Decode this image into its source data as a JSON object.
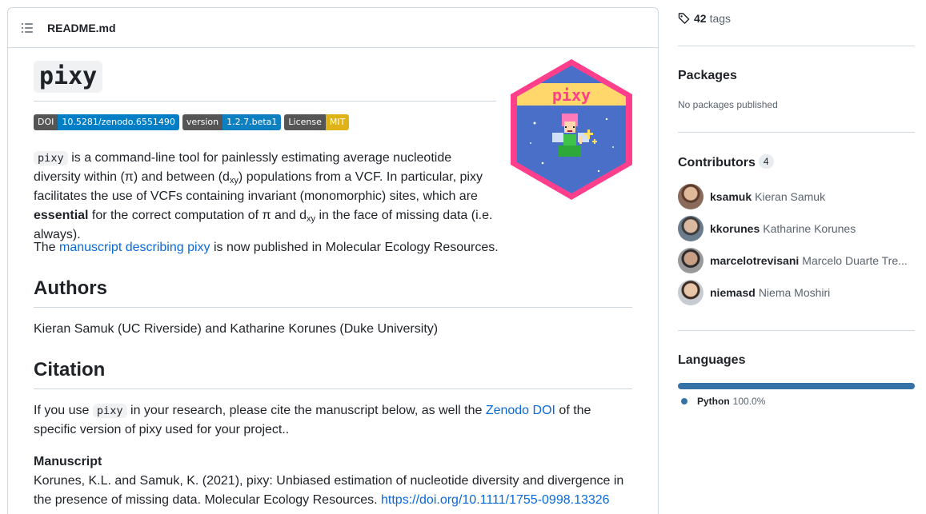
{
  "readme": {
    "filename": "README.md",
    "title": "pixy",
    "badges": [
      {
        "left": "DOI",
        "right": "10.5281/zenodo.6551490",
        "color": "#007ec6"
      },
      {
        "left": "version",
        "right": "1.2.7.beta1",
        "color": "#007ec6"
      },
      {
        "left": "License",
        "right": "MIT",
        "color": "#dfb317"
      }
    ],
    "logo_text": "pixy",
    "intro": {
      "code": "pixy",
      "t1": " is a command-line tool for painlessly estimating average nucleotide",
      "t2a": "diversity within (π) and between (d",
      "sub1": "xy",
      "t2b": ") populations from a VCF. In particular, pixy",
      "t3": "facilitates the use of VCFs containing invariant (monomorphic) sites, which are",
      "bold": "essential",
      "t4a": " for the correct computation of π and d",
      "sub2": "xy",
      "t4b": " in the face of missing data (i.e. always)."
    },
    "manuscript_line": {
      "pre": "The ",
      "link": "manuscript describing pixy",
      "post": " is now published in Molecular Ecology Resources."
    },
    "authors_heading": "Authors",
    "authors_text": "Kieran Samuk (UC Riverside) and Katharine Korunes (Duke University)",
    "citation_heading": "Citation",
    "citation": {
      "pre": "If you use ",
      "code": "pixy",
      "mid": " in your research, please cite the manuscript below, as well the ",
      "link": "Zenodo DOI",
      "post": " of the",
      "line2": "specific version of pixy used for your project.."
    },
    "manuscript_heading": "Manuscript",
    "manuscript_ref": {
      "line1": "Korunes, K.L. and Samuk, K. (2021), pixy: Unbiased estimation of nucleotide diversity and divergence in",
      "line2": "the presence of missing data. Molecular Ecology Resources. ",
      "doi": "https://doi.org/10.1111/1755-0998.13326"
    }
  },
  "sidebar": {
    "tags_count": "42",
    "tags_label": "tags",
    "packages_heading": "Packages",
    "packages_text": "No packages published",
    "contributors_heading": "Contributors",
    "contributors_count": "4",
    "contributors": [
      {
        "login": "ksamuk",
        "name": "Kieran Samuk"
      },
      {
        "login": "kkorunes",
        "name": "Katharine Korunes"
      },
      {
        "login": "marcelotrevisani",
        "name": "Marcelo Duarte Tre..."
      },
      {
        "login": "niemasd",
        "name": "Niema Moshiri"
      }
    ],
    "languages_heading": "Languages",
    "language": {
      "name": "Python",
      "percent": "100.0%",
      "color": "#3572A5"
    }
  }
}
